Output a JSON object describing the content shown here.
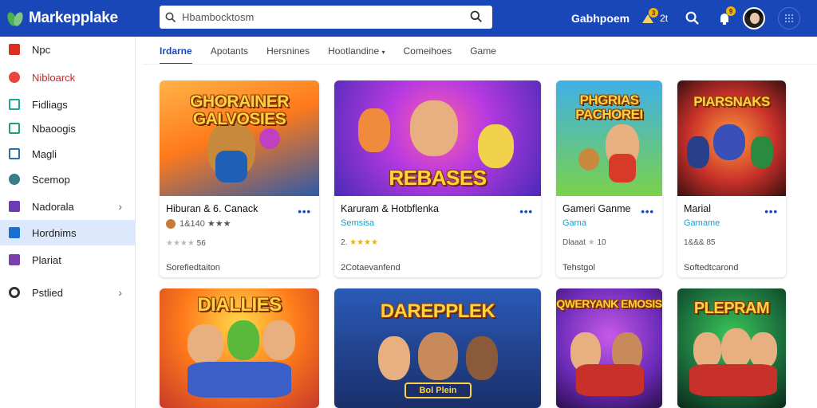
{
  "header": {
    "logo": "Markepplake",
    "search_value": "Hbambocktosm",
    "user": "Gabhpoem",
    "notif_badge": "3",
    "notif_count": "2t",
    "bell_badge": "9"
  },
  "sidebar": {
    "items": [
      {
        "label": "Npc",
        "color": "#d93025"
      },
      {
        "label": "Nibloarck",
        "color": "#e8453c"
      },
      {
        "label": "Fidliags",
        "color": "#1aa89a"
      },
      {
        "label": "Nbaoogis",
        "color": "#1aa07a"
      },
      {
        "label": "Magli",
        "color": "#2c6ea8"
      },
      {
        "label": "Scemop",
        "color": "#3a7d8a"
      },
      {
        "label": "Nadorala",
        "color": "#6a3cb0"
      },
      {
        "label": "Hordnims",
        "color": "#1a6fd0"
      },
      {
        "label": "Plariat",
        "color": "#7a3fa8"
      },
      {
        "label": "Pstlied",
        "color": "#333333"
      }
    ]
  },
  "tabs": [
    "Irdarne",
    "Apotants",
    "Hersnines",
    "Hootlandine",
    "Comeihoes",
    "Game"
  ],
  "cards": [
    {
      "thumb_title": "GHORAINER GALVOSIES",
      "title": "Hiburan & 6. Canack",
      "sub": "",
      "rating": "1&140",
      "meta": "Sorefiedtaiton",
      "stars": 3
    },
    {
      "thumb_title": "REBASES",
      "title": "Karuram & Hotbflenka",
      "sub": "Semsisa",
      "rating": "2.",
      "meta": "2Cotaevanfend",
      "stars": 4
    },
    {
      "thumb_title": "PHGRIAS PACHOREI",
      "title": "Gameri Ganme",
      "sub": "Gama",
      "rating": "Dlaaat",
      "rating_num": "10",
      "meta": "Tehstgol",
      "stars": 2
    },
    {
      "thumb_title": "PIARSNAKS",
      "title": "Marial",
      "sub": "Gamame",
      "rating": "1&&&",
      "rating_num": "85",
      "meta": "Softedtcarond",
      "stars": 2
    },
    {
      "thumb_title": "DIALLIES",
      "title": "",
      "sub": "",
      "rating": "",
      "meta": "",
      "stars": 0
    },
    {
      "thumb_title": "DAREPPLEK",
      "thumb_caption": "Bol Plein",
      "title": "",
      "sub": "",
      "rating": "",
      "meta": "",
      "stars": 0
    },
    {
      "thumb_title": "QWERYANK EMOSIS",
      "title": "",
      "sub": "",
      "rating": "",
      "meta": "",
      "stars": 0
    },
    {
      "thumb_title": "PLEPRAM",
      "title": "",
      "sub": "",
      "rating": "",
      "meta": "",
      "stars": 0
    }
  ]
}
